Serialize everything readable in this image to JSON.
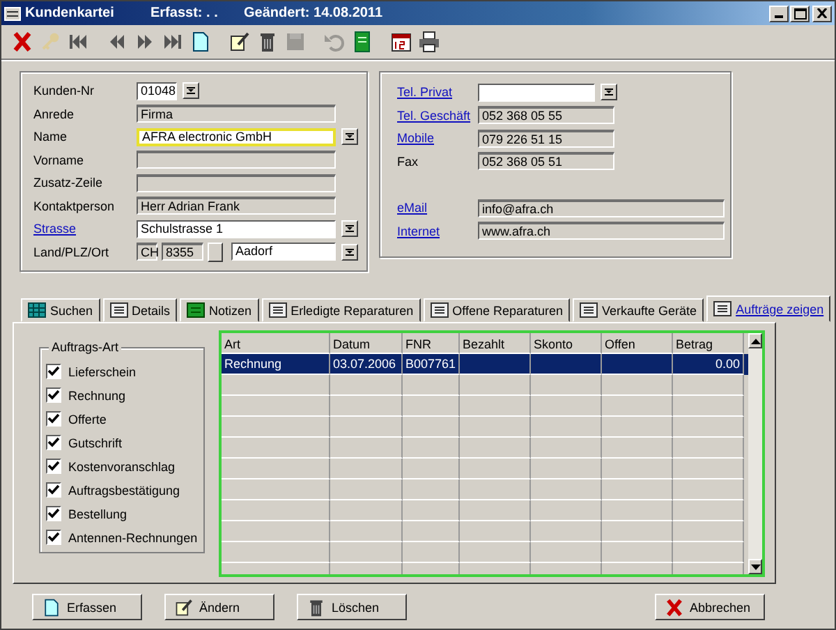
{
  "window": {
    "title": "Kundenkartei",
    "created": "Erfasst:  . .",
    "changed": "Geändert: 14.08.2011"
  },
  "toolbar": [
    {
      "kind": "delete",
      "disabled": false
    },
    {
      "kind": "key",
      "disabled": true
    },
    {
      "kind": "first",
      "disabled": false
    },
    {
      "kind": "prev",
      "disabled": false
    },
    {
      "kind": "next",
      "disabled": false
    },
    {
      "kind": "last",
      "disabled": false
    },
    {
      "kind": "new",
      "disabled": false
    },
    {
      "kind": "edit",
      "disabled": false
    },
    {
      "kind": "trash",
      "disabled": false
    },
    {
      "kind": "save",
      "disabled": true
    },
    {
      "kind": "undo",
      "disabled": true
    },
    {
      "kind": "book",
      "disabled": false
    },
    {
      "kind": "calendar",
      "disabled": false
    },
    {
      "kind": "print",
      "disabled": false
    }
  ],
  "customer": [
    {
      "label": "Kunden-Nr",
      "kind": "code",
      "value": "01048",
      "link": false,
      "focused": false
    },
    {
      "label": "Anrede",
      "kind": "display",
      "value": "Firma",
      "link": false,
      "focused": false
    },
    {
      "label": "Name",
      "kind": "combo",
      "value": "AFRA electronic GmbH",
      "link": false,
      "focused": true
    },
    {
      "label": "Vorname",
      "kind": "display",
      "link": false,
      "focused": false
    },
    {
      "label": "Zusatz-Zeile",
      "kind": "display",
      "link": false,
      "focused": false
    },
    {
      "label": "Kontaktperson",
      "kind": "display",
      "value": "Herr Adrian Frank",
      "link": false,
      "focused": false
    },
    {
      "label": "Strasse",
      "kind": "combo",
      "value": "Schulstrasse 1",
      "link": true,
      "focused": false
    },
    {
      "label": "Land/PLZ/Ort",
      "kind": "address",
      "values": [
        "CH",
        "8355",
        "Aadorf"
      ],
      "link": false,
      "focused": false
    }
  ],
  "contact": [
    {
      "label": "Tel. Privat",
      "kind": "combo",
      "link": true
    },
    {
      "label": "Tel. Geschäft",
      "kind": "display",
      "value": "052 368 05 55",
      "link": true
    },
    {
      "label": "Mobile",
      "kind": "display",
      "value": "079 226 51 15",
      "link": true
    },
    {
      "label": "Fax",
      "kind": "display",
      "value": "052 368 05 51",
      "link": false
    }
  ],
  "online": [
    {
      "label": "eMail",
      "value": "info@afra.ch",
      "link": true
    },
    {
      "label": "Internet",
      "value": "www.afra.ch",
      "link": true
    }
  ],
  "tabs": [
    {
      "label": "Suchen",
      "kind": "grid",
      "selected": false
    },
    {
      "label": "Details",
      "kind": "list",
      "selected": false
    },
    {
      "label": "Notizen",
      "kind": "notes",
      "selected": false
    },
    {
      "label": "Erledigte Reparaturen",
      "kind": "list",
      "selected": false
    },
    {
      "label": "Offene Reparaturen",
      "kind": "list",
      "selected": false
    },
    {
      "label": "Verkaufte Geräte",
      "kind": "list",
      "selected": false
    },
    {
      "label": "Aufträge zeigen",
      "kind": "list",
      "selected": true
    }
  ],
  "order_types": {
    "title": "Auftrags-Art",
    "items": [
      {
        "label": "Lieferschein",
        "checked": true
      },
      {
        "label": "Rechnung",
        "checked": true
      },
      {
        "label": "Offerte",
        "checked": true
      },
      {
        "label": "Gutschrift",
        "checked": true
      },
      {
        "label": "Kostenvoranschlag",
        "checked": true
      },
      {
        "label": "Auftragsbestätigung",
        "checked": true
      },
      {
        "label": "Bestellung",
        "checked": true
      },
      {
        "label": "Antennen-Rechnungen",
        "checked": true
      }
    ]
  },
  "table": {
    "columns": [
      "Art",
      "Datum",
      "FNR",
      "Bezahlt",
      "Skonto",
      "Offen",
      "Betrag"
    ],
    "rows": [
      {
        "cells": [
          "Rechnung",
          "03.07.2006",
          "B007761",
          null,
          null,
          null,
          "0.00"
        ],
        "selected": true
      }
    ]
  },
  "buttons": [
    {
      "label": "Erfassen",
      "kind": "new"
    },
    {
      "label": "Ändern",
      "kind": "edit"
    },
    {
      "label": "Löschen",
      "kind": "trash"
    },
    {
      "label": "Abbrechen",
      "kind": "cancel"
    }
  ]
}
